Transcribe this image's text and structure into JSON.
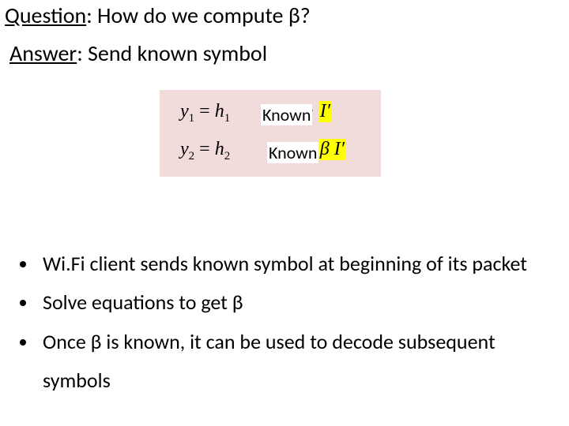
{
  "question": {
    "label": "Question",
    "text": ": How do we compute β?"
  },
  "answer": {
    "label": "Answer",
    "text": ": Send known symbol"
  },
  "equations": {
    "row1_lhs": "y",
    "row1_sub1": "1",
    "row1_eq": " = ",
    "row1_h": "h",
    "row1_sub2": "1",
    "row1_plus": " + ",
    "row1_hl": "I′",
    "row2_lhs": "y",
    "row2_sub1": "2",
    "row2_eq": " = ",
    "row2_h": "h",
    "row2_sub2": "2",
    "row2_plus": " + ",
    "row2_hl": "β I′",
    "known_label": "Known"
  },
  "bullets": [
    "Wi.Fi client sends known symbol at beginning of its packet",
    "Solve equations to get β",
    "Once β is known, it can be used to decode subsequent symbols"
  ]
}
